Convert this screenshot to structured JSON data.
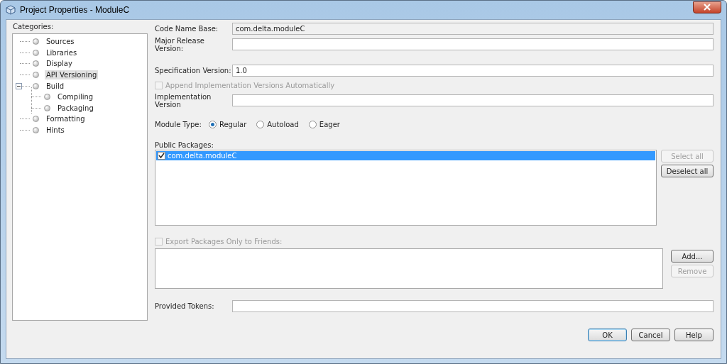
{
  "window": {
    "title": "Project Properties - ModuleC"
  },
  "categories": {
    "label": "Categories:",
    "items": [
      {
        "label": "Sources",
        "selected": false
      },
      {
        "label": "Libraries",
        "selected": false
      },
      {
        "label": "Display",
        "selected": false
      },
      {
        "label": "API Versioning",
        "selected": true
      },
      {
        "label": "Build",
        "selected": false,
        "expanded": true,
        "children": [
          {
            "label": "Compiling",
            "selected": false
          },
          {
            "label": "Packaging",
            "selected": false
          }
        ]
      },
      {
        "label": "Formatting",
        "selected": false
      },
      {
        "label": "Hints",
        "selected": false
      }
    ]
  },
  "field_groups": [
    [
      {
        "kind": "field",
        "label": "Code Name Base:",
        "value": "com.delta.moduleC",
        "disabled": true
      },
      {
        "kind": "field",
        "label": "Major Release Version:",
        "disabled": false
      }
    ],
    [
      {
        "kind": "field",
        "label": "Specification Version:",
        "value": "1.0",
        "disabled": false
      },
      {
        "kind": "checkbox",
        "label": "Append Implementation Versions Automatically",
        "checked": false,
        "disabled": true
      },
      {
        "kind": "field",
        "label": "Implementation Version",
        "disabled": false
      }
    ]
  ],
  "module_type": {
    "label": "Module Type:",
    "options": [
      {
        "label": "Regular",
        "selected": true
      },
      {
        "label": "Autoload",
        "selected": false
      },
      {
        "label": "Eager",
        "selected": false
      }
    ]
  },
  "public_packages": {
    "label": "Public Packages:",
    "items": [
      {
        "label": "com.delta.moduleC",
        "checked": true,
        "selected": true
      }
    ],
    "buttons": [
      {
        "label": "Select all",
        "disabled": true
      },
      {
        "label": "Deselect all",
        "disabled": false
      }
    ]
  },
  "export_packages": {
    "label": "Export Packages Only to Friends:",
    "checked": false,
    "disabled": true,
    "buttons": [
      {
        "label": "Add...",
        "disabled": false
      },
      {
        "label": "Remove",
        "disabled": true
      }
    ]
  },
  "provided_tokens": {
    "label": "Provided Tokens:"
  },
  "footer_buttons": [
    {
      "label": "OK",
      "default": true
    },
    {
      "label": "Cancel",
      "default": false
    },
    {
      "label": "Help",
      "default": false
    }
  ]
}
